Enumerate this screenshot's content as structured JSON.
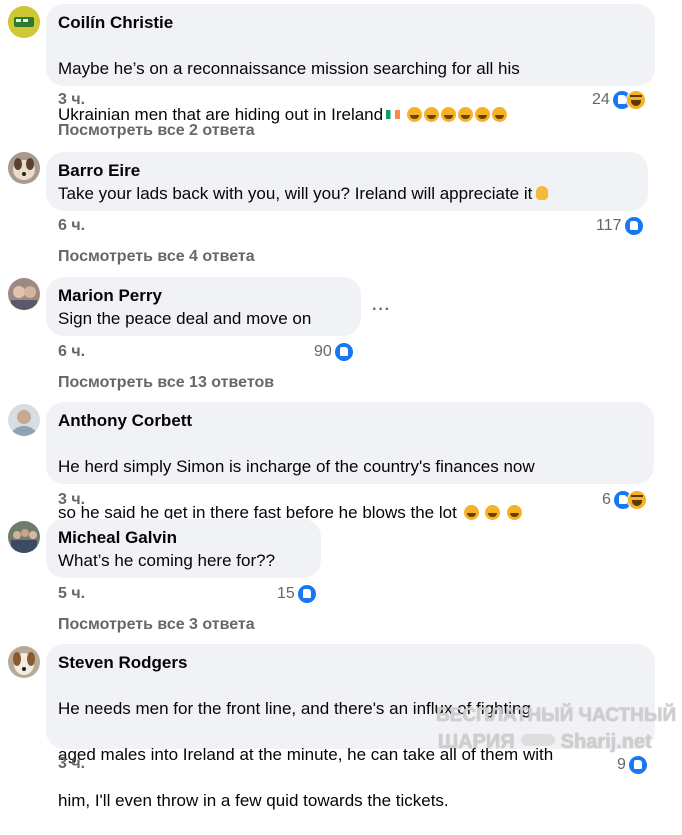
{
  "comments": [
    {
      "author": "Coilín Christie",
      "lines": [
        "Maybe he’s on a reconnaissance mission searching for all his",
        "Ukrainian men that are hiding out in Ireland"
      ],
      "time": "3 ч.",
      "reaction_count": "24",
      "reactions": [
        "like-icon",
        "haha-icon"
      ],
      "replies": "Посмотреть все 2 ответа"
    },
    {
      "author": "Barro Eire",
      "lines": [
        "Take your lads back with you, will you? Ireland will appreciate it"
      ],
      "time": "6 ч.",
      "reaction_count": "117",
      "reactions": [
        "like-icon"
      ],
      "replies": "Посмотреть все 4 ответа"
    },
    {
      "author": "Marion Perry",
      "lines": [
        "Sign the peace deal and move on"
      ],
      "time": "6 ч.",
      "reaction_count": "90",
      "reactions": [
        "like-icon"
      ],
      "replies": "Посмотреть все 13 ответов",
      "more_menu": "···"
    },
    {
      "author": "Anthony Corbett",
      "lines": [
        "He herd simply Simon is incharge of the country's finances now",
        "so he said he get in there fast before he blows the lot"
      ],
      "time": "3 ч.",
      "reaction_count": "6",
      "reactions": [
        "like-icon",
        "haha-icon"
      ]
    },
    {
      "author": "Micheal Galvin",
      "lines": [
        "What’s he coming here for??"
      ],
      "time": "5 ч.",
      "reaction_count": "15",
      "reactions": [
        "like-icon"
      ],
      "replies": "Посмотреть все 3 ответа"
    },
    {
      "author": "Steven Rodgers",
      "lines": [
        "He needs men for the front line, and there's an influx of fighting",
        "aged males into Ireland at the minute, he can take all of them with",
        "him, I'll even throw in a few quid towards the tickets."
      ],
      "time": "3 ч.",
      "reaction_count": "9",
      "reactions": [
        "like-icon"
      ]
    }
  ],
  "watermark": {
    "line1": "БЕСПЛАТНЫЙ ЧАСТНЫЙ",
    "line2a": "ШАРИЯ",
    "line2b": "Sharij.net"
  },
  "colors": {
    "bubble": "#f0f2f5",
    "meta_text": "#65676b",
    "like_blue": "#1877f2",
    "haha_yellow": "#f7b125"
  }
}
